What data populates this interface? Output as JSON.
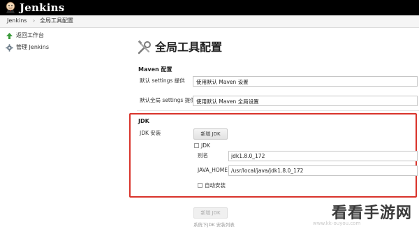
{
  "header": {
    "brand": "Jenkins",
    "colors": {
      "bar": "#000000",
      "brand_text": "#ffffff"
    }
  },
  "breadcrumb": {
    "items": [
      "Jenkins",
      "全局工具配置"
    ],
    "separator": "›"
  },
  "sidebar": {
    "items": [
      {
        "label": "返回工作台",
        "icon": "up-arrow-icon"
      },
      {
        "label": "管理 Jenkins",
        "icon": "gear-icon"
      }
    ]
  },
  "page": {
    "title": "全局工具配置",
    "title_icon": "tools-icon"
  },
  "maven": {
    "heading": "Maven 配置",
    "settings_label": "默认 settings 提供",
    "settings_value": "使用默认 Maven 设置",
    "global_settings_label": "默认全局 settings 提供",
    "global_settings_value": "使用默认 Maven 全局设置"
  },
  "jdk": {
    "heading": "JDK",
    "install_label": "JDK 安装",
    "add_button": "新增 JDK",
    "checkbox_label": "JDK",
    "alias_label": "别名",
    "alias_value": "jdk1.8.0_172",
    "java_home_label": "JAVA_HOME",
    "java_home_value": "/usr/local/java/jdk1.8.0_172",
    "auto_install_label": "自动安装",
    "auto_install_checked": false,
    "add_button_bottom": "新增 JDK",
    "footer_note": "系统下JDK 安装列表",
    "highlight_color": "#d9332b"
  },
  "watermark": {
    "text": "看看手游网",
    "ghost": "www.kk-ouyou.com"
  }
}
